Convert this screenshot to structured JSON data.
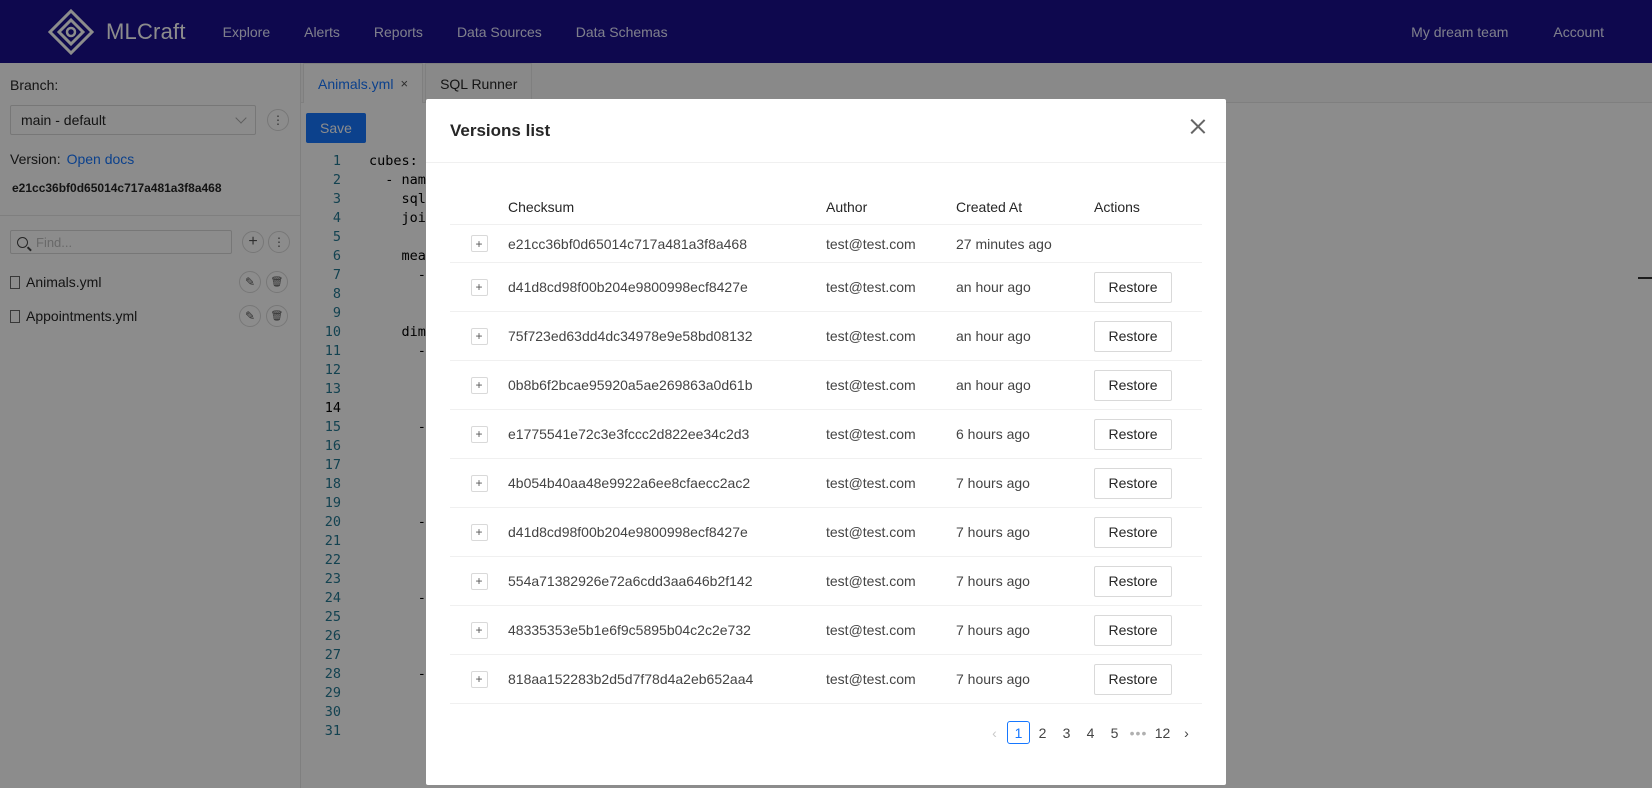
{
  "brand": {
    "name": "MLCraft"
  },
  "nav": {
    "links": [
      "Explore",
      "Alerts",
      "Reports",
      "Data Sources",
      "Data Schemas"
    ],
    "right": [
      "My dream team",
      "Account"
    ]
  },
  "sidebar": {
    "branch_label": "Branch:",
    "branch_value": "main - default",
    "version_label": "Version:",
    "version_link": "Open docs",
    "version_checksum": "e21cc36bf0d65014c717a481a3f8a468",
    "find_placeholder": "Find...",
    "files": [
      "Animals.yml",
      "Appointments.yml"
    ]
  },
  "editor": {
    "tabs": [
      {
        "label": "Animals.yml",
        "close": "×"
      },
      {
        "label": "SQL Runner"
      }
    ],
    "save_label": "Save",
    "current_line": 14,
    "lines": [
      "cubes:",
      "  - nam",
      "    sql",
      "    joi",
      "",
      "    mea",
      "      -",
      "      ",
      "",
      "    dim",
      "      -",
      "      ",
      "      ",
      "",
      "      -",
      "      ",
      "      ",
      "      ",
      "      ",
      "      -",
      "      ",
      "      ",
      "      ",
      "      -",
      "      ",
      "      ",
      "      ",
      "      -",
      "      ",
      "      ",
      ""
    ]
  },
  "modal": {
    "title": "Versions list",
    "columns": {
      "checksum": "Checksum",
      "author": "Author",
      "created": "Created At",
      "actions": "Actions"
    },
    "expand_glyph": "+",
    "restore_label": "Restore",
    "rows": [
      {
        "checksum": "e21cc36bf0d65014c717a481a3f8a468",
        "author": "test@test.com",
        "created": "27 minutes ago",
        "restorable": false
      },
      {
        "checksum": "d41d8cd98f00b204e9800998ecf8427e",
        "author": "test@test.com",
        "created": "an hour ago",
        "restorable": true
      },
      {
        "checksum": "75f723ed63dd4dc34978e9e58bd08132",
        "author": "test@test.com",
        "created": "an hour ago",
        "restorable": true
      },
      {
        "checksum": "0b8b6f2bcae95920a5ae269863a0d61b",
        "author": "test@test.com",
        "created": "an hour ago",
        "restorable": true
      },
      {
        "checksum": "e1775541e72c3e3fccc2d822ee34c2d3",
        "author": "test@test.com",
        "created": "6 hours ago",
        "restorable": true
      },
      {
        "checksum": "4b054b40aa48e9922a6ee8cfaecc2ac2",
        "author": "test@test.com",
        "created": "7 hours ago",
        "restorable": true
      },
      {
        "checksum": "d41d8cd98f00b204e9800998ecf8427e",
        "author": "test@test.com",
        "created": "7 hours ago",
        "restorable": true
      },
      {
        "checksum": "554a71382926e72a6cdd3aa646b2f142",
        "author": "test@test.com",
        "created": "7 hours ago",
        "restorable": true
      },
      {
        "checksum": "48335353e5b1e6f9c5895b04c2c2e732",
        "author": "test@test.com",
        "created": "7 hours ago",
        "restorable": true
      },
      {
        "checksum": "818aa152283b2d5d7f78d4a2eb652aa4",
        "author": "test@test.com",
        "created": "7 hours ago",
        "restorable": true
      }
    ],
    "pagination": {
      "prev": "‹",
      "next": "›",
      "pages": [
        "1",
        "2",
        "3",
        "4",
        "5"
      ],
      "ellipsis": "•••",
      "last": "12",
      "current": "1"
    }
  }
}
